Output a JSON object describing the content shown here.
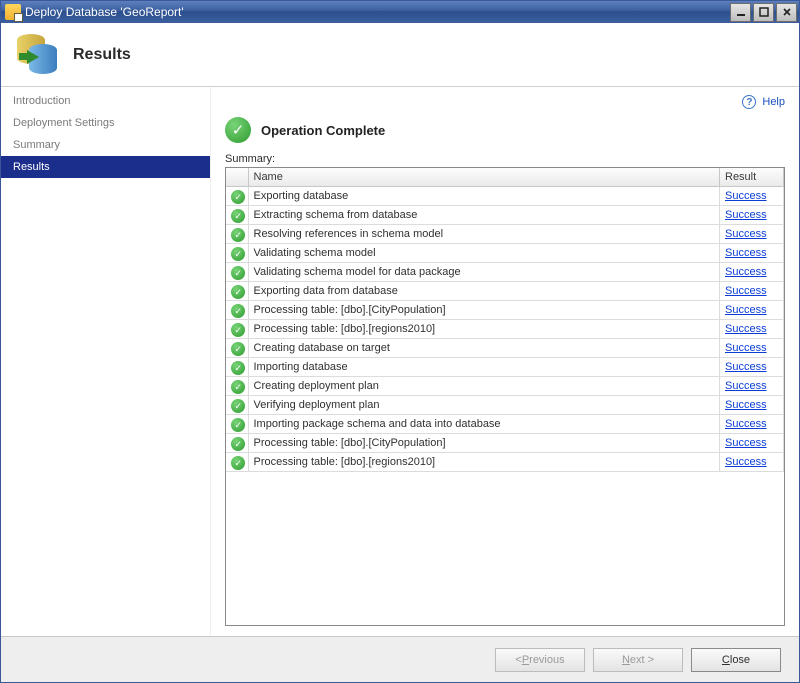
{
  "titlebar": {
    "title": "Deploy Database 'GeoReport'"
  },
  "header": {
    "title": "Results"
  },
  "sidebar": {
    "items": [
      {
        "label": "Introduction",
        "active": false
      },
      {
        "label": "Deployment Settings",
        "active": false
      },
      {
        "label": "Summary",
        "active": false
      },
      {
        "label": "Results",
        "active": true
      }
    ]
  },
  "help": {
    "label": "Help"
  },
  "status": {
    "text": "Operation Complete"
  },
  "summary": {
    "label": "Summary:",
    "columns": {
      "name": "Name",
      "result": "Result"
    },
    "rows": [
      {
        "name": "Exporting database",
        "result": "Success"
      },
      {
        "name": "Extracting schema from database",
        "result": "Success"
      },
      {
        "name": "Resolving references in schema model",
        "result": "Success"
      },
      {
        "name": "Validating schema model",
        "result": "Success"
      },
      {
        "name": "Validating schema model for data package",
        "result": "Success"
      },
      {
        "name": "Exporting data from database",
        "result": "Success"
      },
      {
        "name": "Processing table: [dbo].[CityPopulation]",
        "result": "Success"
      },
      {
        "name": "Processing table: [dbo].[regions2010]",
        "result": "Success"
      },
      {
        "name": "Creating database on target",
        "result": "Success"
      },
      {
        "name": "Importing database",
        "result": "Success"
      },
      {
        "name": "Creating deployment plan",
        "result": "Success"
      },
      {
        "name": "Verifying deployment plan",
        "result": "Success"
      },
      {
        "name": "Importing package schema and data into database",
        "result": "Success"
      },
      {
        "name": "Processing table: [dbo].[CityPopulation]",
        "result": "Success"
      },
      {
        "name": "Processing table: [dbo].[regions2010]",
        "result": "Success"
      }
    ]
  },
  "footer": {
    "previous_html": "< <span class='u'>P</span>revious",
    "next_html": "<span class='u'>N</span>ext >",
    "close_html": "<span class='u'>C</span>lose"
  },
  "colors": {
    "accent_blue": "#1c2e8c",
    "link_blue": "#0b3dd6",
    "success_green": "#2e9b2e"
  }
}
